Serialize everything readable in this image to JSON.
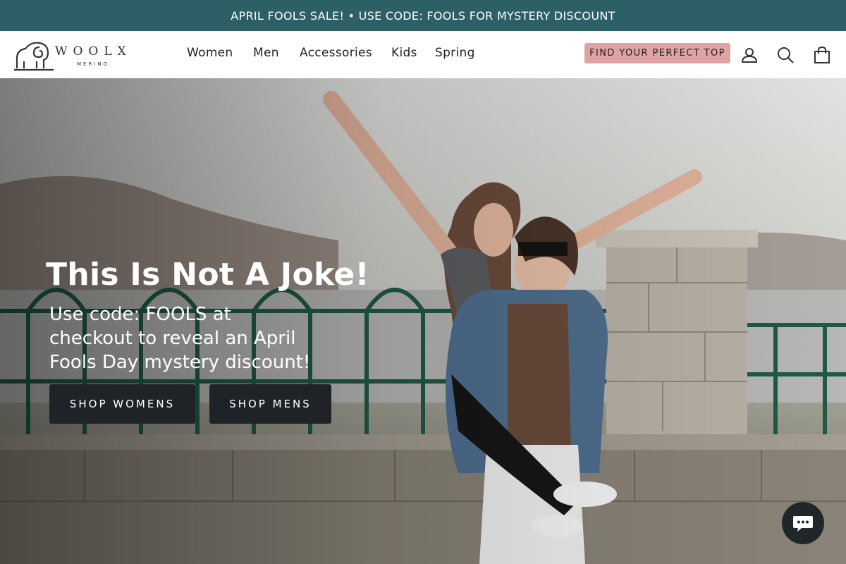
{
  "announcement": {
    "text": "APRIL FOOLS SALE! • USE CODE: FOOLS FOR MYSTERY DISCOUNT"
  },
  "header": {
    "logo": {
      "word": "WOOLX",
      "sub": "MERINO"
    },
    "nav": [
      {
        "label": "Women"
      },
      {
        "label": "Men"
      },
      {
        "label": "Accessories"
      },
      {
        "label": "Kids"
      },
      {
        "label": "Spring"
      }
    ],
    "quiz_button": "FIND YOUR PERFECT TOP",
    "icons": [
      "account-icon",
      "search-icon",
      "cart-icon"
    ]
  },
  "hero": {
    "title": "This Is Not A Joke!",
    "subtitle": "Use code: FOOLS at checkout to reveal an April Fools Day mystery discount!",
    "buttons": [
      {
        "label": "SHOP WOMENS"
      },
      {
        "label": "SHOP MENS"
      }
    ]
  },
  "chat": {
    "icon": "chat-icon"
  },
  "colors": {
    "announcement_bg": "#2c5f66",
    "quiz_button_bg": "#e0a3a3",
    "hero_button_bg": "#1f2328"
  }
}
